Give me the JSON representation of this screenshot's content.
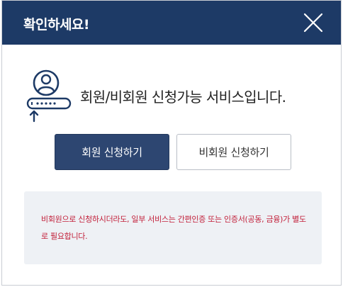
{
  "dialog": {
    "title": "확인하세요!",
    "headline": "회원/비회원 신청가능 서비스입니다.",
    "close_icon": "close-icon",
    "member_icon": "member-login-icon"
  },
  "buttons": {
    "member_apply": "회원 신청하기",
    "guest_apply": "비회원 신청하기"
  },
  "notice": {
    "text": "비회원으로 신청하시더라도, 일부 서비스는 간편인증 또는 인증서(공동, 금융)가 별도로 필요합니다."
  },
  "colors": {
    "header": "#1d3a66",
    "primary_button": "#2d4671",
    "notice_text": "#c2203a",
    "notice_bg": "#eef1f5",
    "icon": "#1d3a66"
  }
}
